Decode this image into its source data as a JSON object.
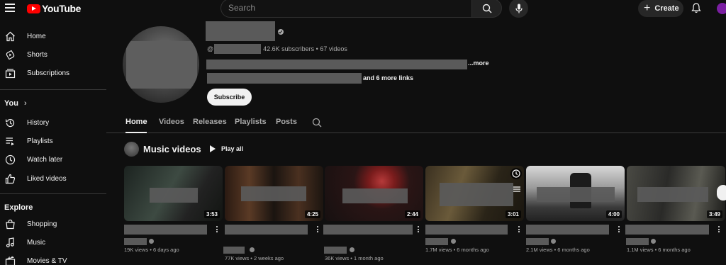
{
  "topbar": {
    "logo_text": "YouTube",
    "search_placeholder": "Search",
    "create_label": "Create"
  },
  "sidebar": {
    "main": [
      {
        "label": "Home",
        "icon": "home-icon"
      },
      {
        "label": "Shorts",
        "icon": "shorts-icon"
      },
      {
        "label": "Subscriptions",
        "icon": "subscriptions-icon"
      }
    ],
    "you_heading": "You",
    "you": [
      {
        "label": "History",
        "icon": "history-icon"
      },
      {
        "label": "Playlists",
        "icon": "playlists-icon"
      },
      {
        "label": "Watch later",
        "icon": "watch-later-icon"
      },
      {
        "label": "Liked videos",
        "icon": "liked-icon"
      }
    ],
    "explore_heading": "Explore",
    "explore": [
      {
        "label": "Shopping",
        "icon": "shopping-icon"
      },
      {
        "label": "Music",
        "icon": "music-icon"
      },
      {
        "label": "Movies & TV",
        "icon": "movies-icon"
      }
    ]
  },
  "channel": {
    "handle_prefix": "@",
    "stats": "42.6K subscribers • 67 videos",
    "more_label": "...more",
    "links_label": "and 6 more links",
    "subscribe_label": "Subscribe"
  },
  "tabs": [
    "Home",
    "Videos",
    "Releases",
    "Playlists",
    "Posts"
  ],
  "section": {
    "title": "Music videos",
    "play_all_label": "Play all"
  },
  "videos": [
    {
      "duration": "3:53",
      "meta": "19K views • 6 days ago"
    },
    {
      "duration": "4:25",
      "meta": "77K views • 2 weeks ago"
    },
    {
      "duration": "2:44",
      "meta": "36K views • 1 month ago"
    },
    {
      "duration": "3:01",
      "meta": "1.7M views • 6 months ago"
    },
    {
      "duration": "4:00",
      "meta": "2.1M views • 6 months ago"
    },
    {
      "duration": "3:49",
      "meta": "1.1M views • 6 months ago"
    }
  ],
  "colors": {
    "background": "#0f0f0f",
    "brand_red": "#ff0000",
    "text_primary": "#f1f1f1",
    "text_secondary": "#aaaaaa"
  }
}
